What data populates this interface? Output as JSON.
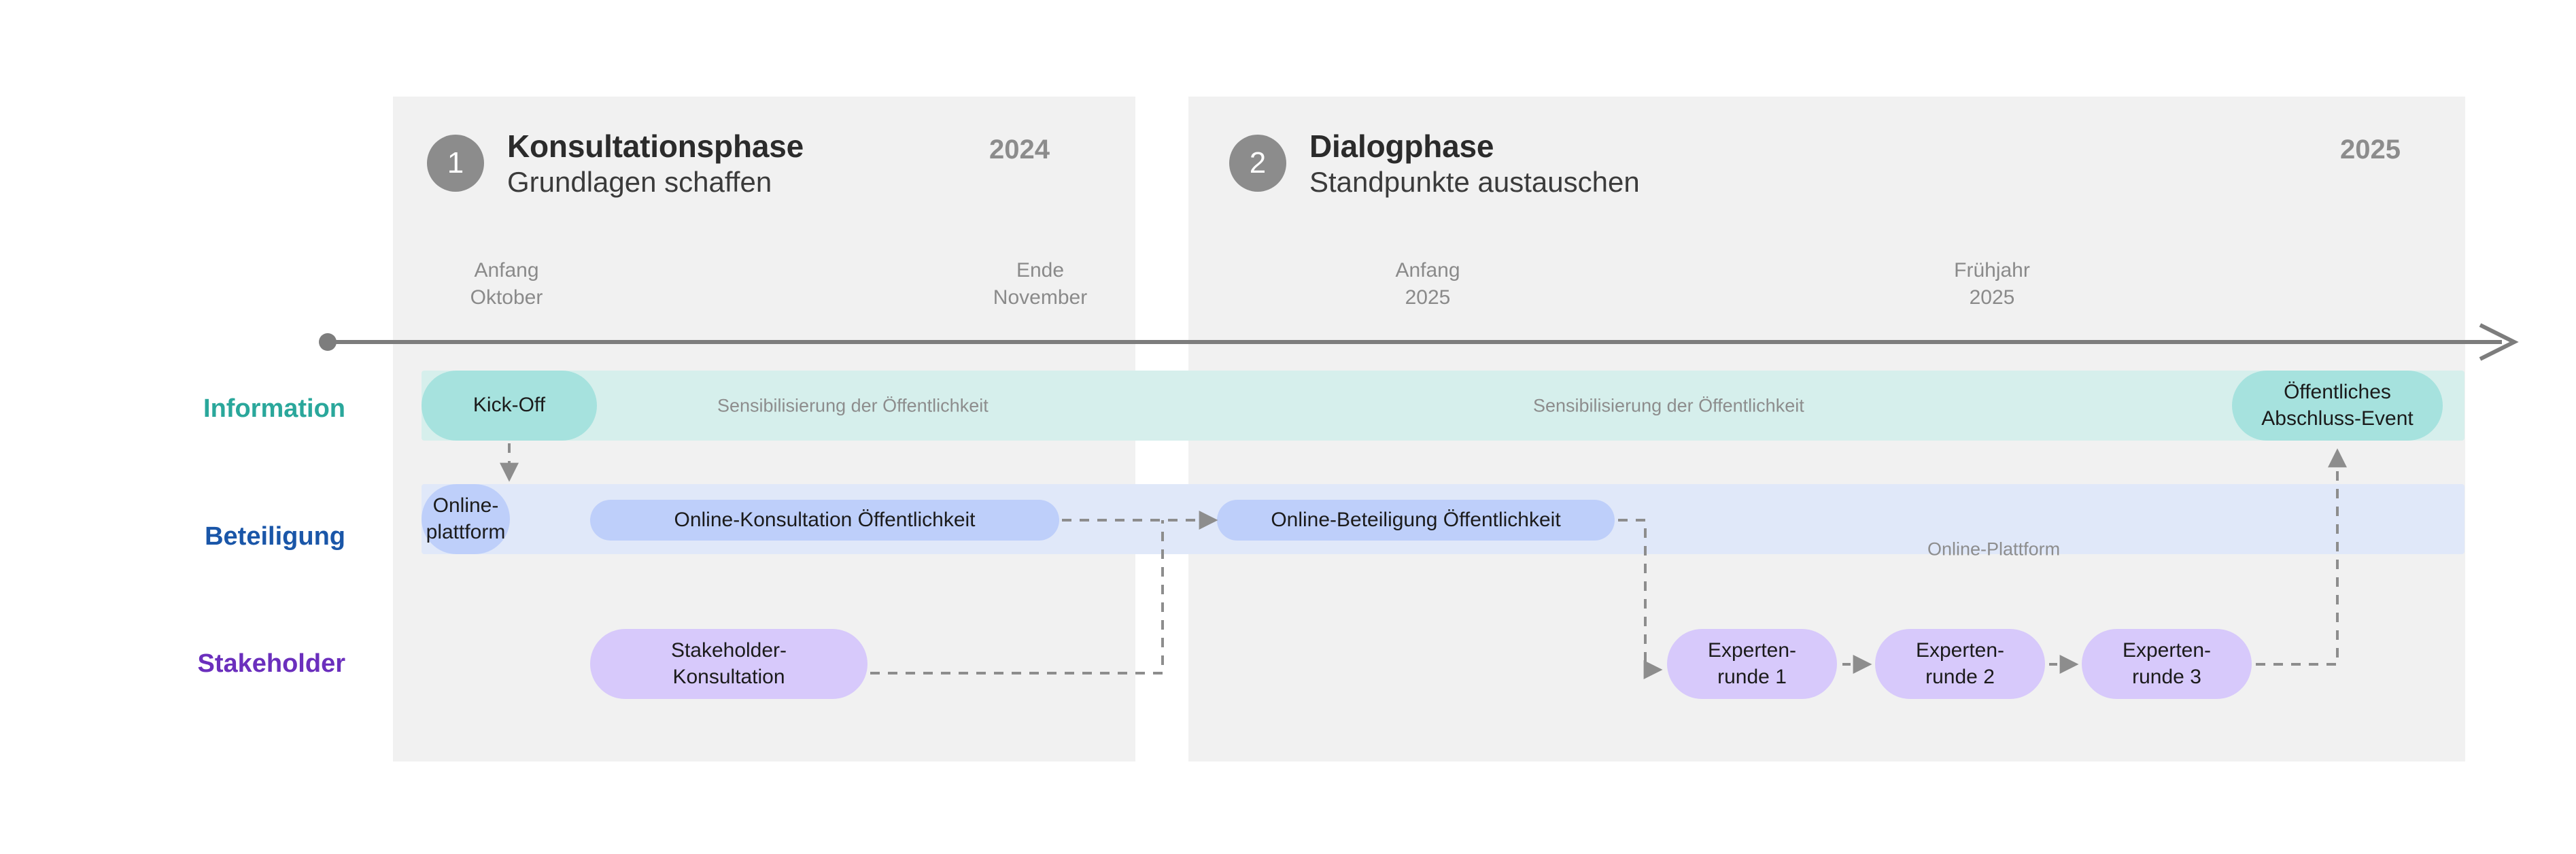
{
  "phases": [
    {
      "number": "1",
      "title": "Konsultationsphase",
      "subtitle": "Grundlagen schaffen",
      "year": "2024",
      "start_label_line1": "Anfang",
      "start_label_line2": "Oktober",
      "end_label_line1": "Ende",
      "end_label_line2": "November"
    },
    {
      "number": "2",
      "title": "Dialogphase",
      "subtitle": "Standpunkte austauschen",
      "year": "2025",
      "start_label_line1": "Anfang",
      "start_label_line2": "2025",
      "end_label_line1": "Frühjahr",
      "end_label_line2": "2025"
    }
  ],
  "rows": [
    {
      "label": "Information",
      "color": "#2aa79b"
    },
    {
      "label": "Beteiligung",
      "color": "#1a56a8"
    },
    {
      "label": "Stakeholder",
      "color": "#6b2fbd"
    }
  ],
  "information": {
    "kickoff": "Kick-Off",
    "caption_phase1": "Sensibilisierung der Öffentlichkeit",
    "caption_phase2": "Sensibilisierung der Öffentlichkeit",
    "closing_event_line1": "Öffentliches",
    "closing_event_line2": "Abschluss-Event",
    "band_color": "#d6efec",
    "pill_color": "#a6e2de"
  },
  "beteiligung": {
    "platform_line1": "Online-",
    "platform_line2": "plattform",
    "consultation": "Online-Konsultation Öffentlichkeit",
    "participation": "Online-Beteiligung Öffentlichkeit",
    "caption_phase2": "Online-Plattform",
    "band_color": "#e0e8f9",
    "pill_color": "#becffa"
  },
  "stakeholder": {
    "konsultation_line1": "Stakeholder-",
    "konsultation_line2": "Konsultation",
    "expert_rounds": [
      {
        "line1": "Experten-",
        "line2": "runde 1"
      },
      {
        "line1": "Experten-",
        "line2": "runde 2"
      },
      {
        "line1": "Experten-",
        "line2": "runde 3"
      }
    ],
    "pill_color": "#d7c9fb"
  },
  "axis": {
    "color": "#7d7d7d"
  }
}
